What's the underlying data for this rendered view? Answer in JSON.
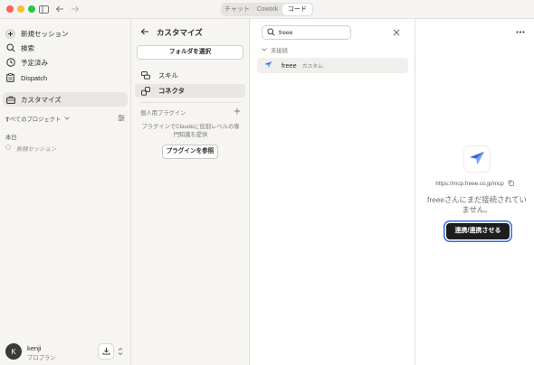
{
  "titlebar": {
    "tabs": [
      {
        "label": "チャット",
        "active": false
      },
      {
        "label": "Cowork",
        "active": false
      },
      {
        "label": "コード",
        "active": true
      }
    ]
  },
  "sidebar": {
    "nav": [
      {
        "label": "新規セッション",
        "icon": "plus-circle-icon"
      },
      {
        "label": "検索",
        "icon": "search-icon"
      },
      {
        "label": "予定済み",
        "icon": "clock-icon"
      },
      {
        "label": "Dispatch",
        "icon": "clipboard-icon"
      }
    ],
    "customize_label": "カスタマイズ",
    "projects_label": "すべてのプロジェクト",
    "today_label": "本日",
    "session_label": "新規セッション",
    "user": {
      "initial": "K",
      "name": "kenji",
      "plan": "プロプラン"
    }
  },
  "customize": {
    "title": "カスタマイズ",
    "folder_button": "フォルダを選択",
    "items": [
      {
        "label": "スキル",
        "icon": "skill-icon",
        "active": false
      },
      {
        "label": "コネクタ",
        "icon": "connector-icon",
        "active": true
      }
    ],
    "plugins_label": "個人用プラグイン",
    "plugins_desc": "プラグインでClaudeに役割レベルの専門知識を提供",
    "browse_button": "プラグインを参照"
  },
  "connectors": {
    "search_value": "freee",
    "group_label": "未接続",
    "items": [
      {
        "name": "freee",
        "tag": "カスタム"
      }
    ]
  },
  "detail": {
    "url": "https://mcp.freee.co.jp/mcp",
    "message": "freeeさんにまだ接続されていません。",
    "connect_button": "連携/連携させる"
  },
  "colors": {
    "accent": "#2e6fdb",
    "dark_button": "#1e1e1e",
    "freee_brand": "#2864f0"
  }
}
